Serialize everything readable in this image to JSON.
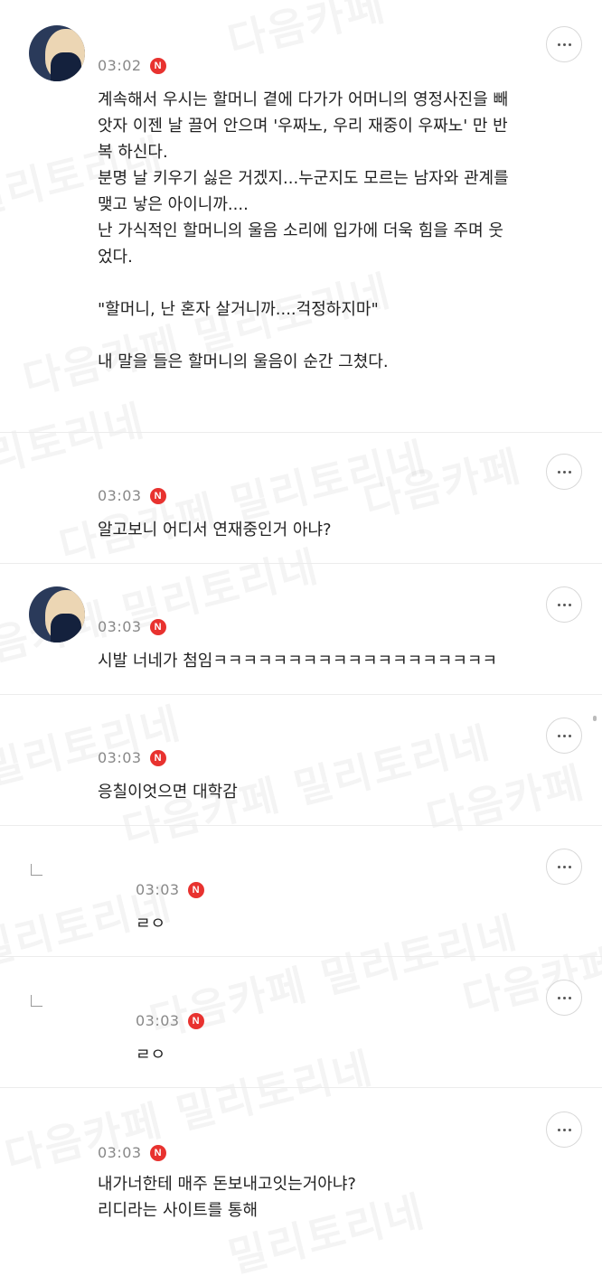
{
  "watermark": {
    "text": "다음카페 밀리토리네",
    "text2": "밀리토리네",
    "text3": "다음카페"
  },
  "badge_label": "N",
  "comments": [
    {
      "time": "03:02",
      "has_avatar": true,
      "text": "계속해서 우시는 할머니 곁에 다가가 어머니의 영정사진을 빼\n앗자 이젠 날 끌어 안으며 '우짜노, 우리 재중이 우짜노' 만 반\n복 하신다.\n분명 날 키우기 싫은 거겠지...누군지도 모르는 남자와 관계를\n맺고 낳은 아이니까....\n난 가식적인 할머니의 울음 소리에 입가에 더욱 힘을 주며 웃\n었다.\n\n\"할머니, 난 혼자 살거니까....걱정하지마\"\n\n내 말을 들은 할머니의 울음이 순간 그쳤다."
    },
    {
      "time": "03:03",
      "has_avatar": false,
      "text": "알고보니 어디서 연재중인거 아냐?"
    },
    {
      "time": "03:03",
      "has_avatar": true,
      "text": "시발 너네가 첨임ㅋㅋㅋㅋㅋㅋㅋㅋㅋㅋㅋㅋㅋㅋㅋㅋㅋㅋㅋ"
    },
    {
      "time": "03:03",
      "has_avatar": false,
      "text": "응칠이엇으면 대학감"
    },
    {
      "time": "03:03",
      "is_reply": true,
      "text": "ㄹㅇ"
    },
    {
      "time": "03:03",
      "is_reply": true,
      "text": "ㄹㅇ"
    },
    {
      "time": "03:03",
      "has_avatar": false,
      "text": "내가너한테 매주 돈보내고잇는거아냐?\n리디라는 사이트를 통해"
    }
  ]
}
